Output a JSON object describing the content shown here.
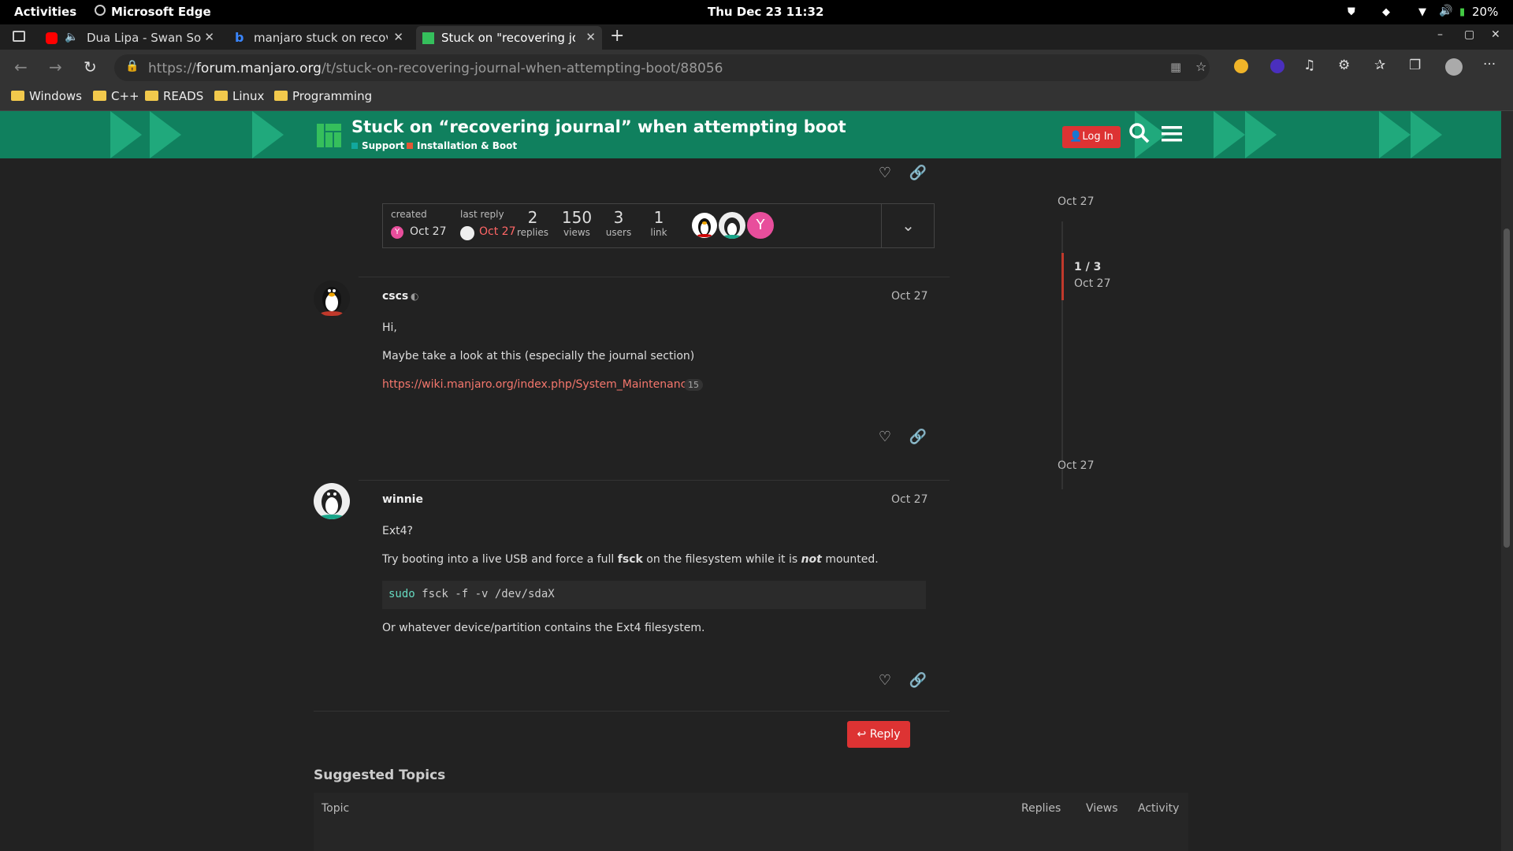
{
  "system_bar": {
    "activities": "Activities",
    "app_name": "Microsoft Edge",
    "clock": "Thu Dec 23  11:32",
    "battery": "20%"
  },
  "tabs": [
    {
      "title": "Dua Lipa - Swan Song",
      "favicon": "youtube-icon"
    },
    {
      "title": "manjaro stuck on recovering journal",
      "favicon": "bing-icon"
    },
    {
      "title": "Stuck on \"recovering journal\"",
      "favicon": "manjaro-icon",
      "active": true
    }
  ],
  "address_bar": {
    "url_prefix": "https://",
    "url_domain": "forum.manjaro.org",
    "url_path": "/t/stuck-on-recovering-journal-when-attempting-boot/88056"
  },
  "bookmarks": [
    "Windows",
    "C++",
    "READS",
    "Linux",
    "Programming"
  ],
  "forum_header": {
    "title": "Stuck on “recovering journal” when attempting boot",
    "category": "Support",
    "subcategory": "Installation & Boot",
    "login_label": "Log In",
    "colors": {
      "header": "#10805e",
      "chevron": "#20a97c",
      "support": "#12a89d",
      "install": "#e45735"
    }
  },
  "topic_map": {
    "created_label": "created",
    "created_date": "Oct 27",
    "last_reply_label": "last reply",
    "last_reply_date": "Oct 27",
    "replies": "2",
    "replies_label": "replies",
    "views": "150",
    "views_label": "views",
    "users": "3",
    "users_label": "users",
    "links": "1",
    "links_label": "link"
  },
  "posts": [
    {
      "username": "cscs",
      "date": "Oct 27",
      "lines": [
        "Hi,",
        "Maybe take a look at this (especially the journal section)"
      ],
      "link": "https://wiki.manjaro.org/index.php/System_Maintenance",
      "link_count": "15"
    },
    {
      "username": "winnie",
      "date": "Oct 27",
      "line1": "Ext4?",
      "line2_a": "Try booting into a live USB and force a full ",
      "line2_b": "fsck",
      "line2_c": " on the filesystem while it is ",
      "line2_d": "not",
      "line2_e": " mounted.",
      "code_cmd": "sudo",
      "code_rest": " fsck -f -v /dev/sdaX",
      "line3": "Or whatever device/partition contains the Ext4 filesystem."
    }
  ],
  "reply_label": "Reply",
  "timeline": {
    "top_date": "Oct 27",
    "position": "1 / 3",
    "position_date": "Oct 27",
    "bottom_date": "Oct 27"
  },
  "suggested": {
    "heading": "Suggested Topics",
    "columns": [
      "Topic",
      "Replies",
      "Views",
      "Activity"
    ]
  }
}
